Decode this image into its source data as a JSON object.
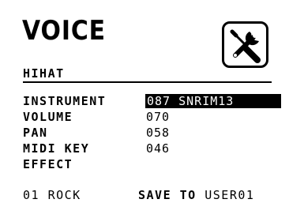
{
  "header": {
    "title": "VOICE",
    "tools_icon": "tools-icon"
  },
  "section": {
    "name": "HIHAT"
  },
  "parameters": [
    {
      "label": "INSTRUMENT",
      "value": "087 SNRIM13",
      "selected": true
    },
    {
      "label": "VOLUME",
      "value": "070"
    },
    {
      "label": "PAN",
      "value": "058"
    },
    {
      "label": "MIDI KEY",
      "value": "046"
    },
    {
      "label": "EFFECT",
      "value": ""
    }
  ],
  "footer": {
    "kit": "01 ROCK",
    "save_prefix": "SAVE TO",
    "save_target": "USER01"
  },
  "colors": {
    "foreground": "#000000",
    "background": "#ffffff",
    "highlight_text": "#ffffff"
  }
}
